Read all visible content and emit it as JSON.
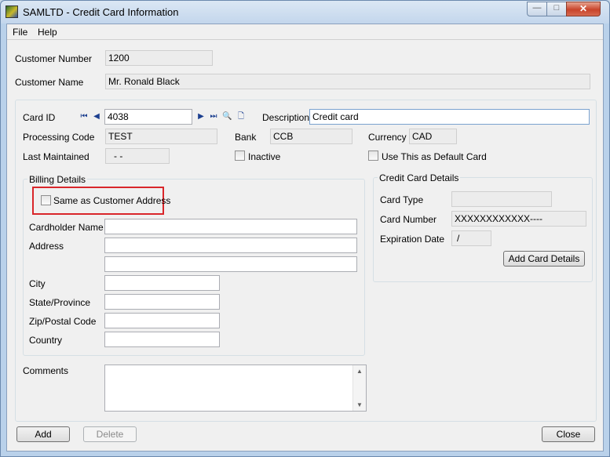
{
  "window": {
    "title": "SAMLTD - Credit Card Information",
    "min_glyph": "—",
    "max_glyph": "□",
    "close_glyph": "✕"
  },
  "menu": {
    "file": "File",
    "help": "Help"
  },
  "customer": {
    "number_label": "Customer Number",
    "number": "1200",
    "name_label": "Customer Name",
    "name": "Mr. Ronald Black"
  },
  "card": {
    "id_label": "Card ID",
    "id": "4038",
    "description_label": "Description",
    "description": "Credit card",
    "processing_code_label": "Processing Code",
    "processing_code": "TEST",
    "bank_label": "Bank",
    "bank": "CCB",
    "currency_label": "Currency",
    "currency": "CAD",
    "last_maintained_label": "Last Maintained",
    "last_maintained": "-  -",
    "inactive_label": "Inactive",
    "default_card_label": "Use This as Default Card"
  },
  "nav_icons": {
    "first": "⏮",
    "prev": "◀",
    "next": "▶",
    "last": "⏭",
    "finder": "🔍",
    "new": "🗋"
  },
  "billing": {
    "title": "Billing Details",
    "same_as_label": "Same as Customer Address",
    "cardholder_label": "Cardholder Name",
    "address_label": "Address",
    "city_label": "City",
    "state_label": "State/Province",
    "zip_label": "Zip/Postal Code",
    "country_label": "Country"
  },
  "cc_details": {
    "title": "Credit Card Details",
    "card_type_label": "Card Type",
    "card_type": "",
    "card_number_label": "Card Number",
    "card_number": "XXXXXXXXXXXX----",
    "expiration_label": "Expiration Date",
    "expiration": " /",
    "add_button": "Add Card Details"
  },
  "comments": {
    "label": "Comments"
  },
  "buttons": {
    "add": "Add",
    "delete": "Delete",
    "close": "Close"
  }
}
